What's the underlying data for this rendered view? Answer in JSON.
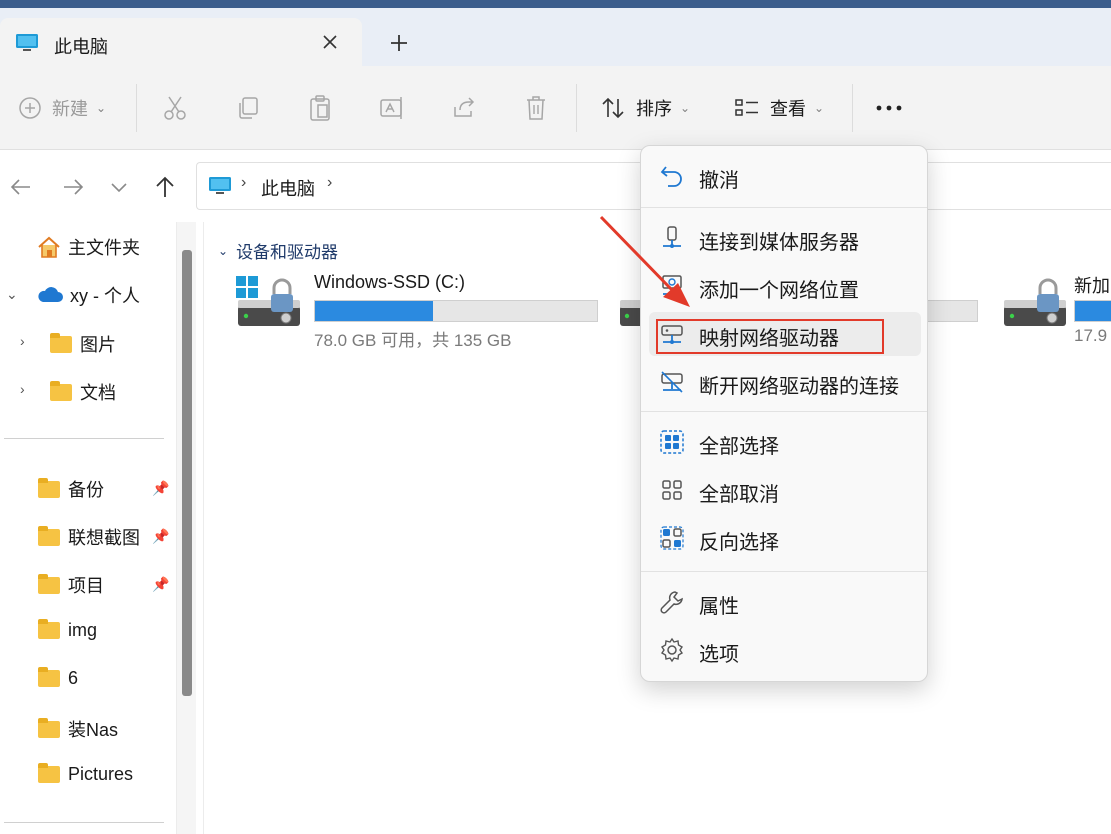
{
  "window": {
    "tab_title": "此电脑"
  },
  "toolbar": {
    "new_label": "新建",
    "sort_label": "排序",
    "view_label": "查看"
  },
  "address": {
    "crumb": "此电脑",
    "separator": "›"
  },
  "sidebar": {
    "home": "主文件夹",
    "onedrive": "xy - 个人",
    "pictures": "图片",
    "documents": "文档",
    "pinned": [
      {
        "label": "备份",
        "pinned": true
      },
      {
        "label": "联想截图",
        "pinned": true
      },
      {
        "label": "项目",
        "pinned": true
      },
      {
        "label": "img",
        "pinned": false
      },
      {
        "label": "6",
        "pinned": false
      },
      {
        "label": "装Nas",
        "pinned": false
      },
      {
        "label": "Pictures",
        "pinned": false
      }
    ]
  },
  "content": {
    "group_title": "设备和驱动器",
    "drives": [
      {
        "name": "Windows-SSD (C:)",
        "info": "78.0 GB 可用，共 135 GB",
        "used_fraction": 0.42
      },
      {
        "name": "",
        "info": "",
        "used_fraction": 0.0
      },
      {
        "name": "新加",
        "info": "17.9",
        "used_fraction": 1.0
      }
    ]
  },
  "context_menu": {
    "items": [
      {
        "label": "撤消",
        "icon": "undo-icon"
      },
      {
        "label": "连接到媒体服务器",
        "icon": "media-server-icon"
      },
      {
        "label": "添加一个网络位置",
        "icon": "network-location-icon"
      },
      {
        "label": "映射网络驱动器",
        "icon": "map-drive-icon"
      },
      {
        "label": "断开网络驱动器的连接",
        "icon": "disconnect-drive-icon"
      },
      {
        "label": "全部选择",
        "icon": "select-all-icon"
      },
      {
        "label": "全部取消",
        "icon": "select-none-icon"
      },
      {
        "label": "反向选择",
        "icon": "invert-selection-icon"
      },
      {
        "label": "属性",
        "icon": "wrench-icon"
      },
      {
        "label": "选项",
        "icon": "gear-icon"
      }
    ]
  },
  "colors": {
    "accent": "#2b8ae0",
    "highlight_box": "#e23a2a",
    "title_edge": "#3b5d8c"
  }
}
